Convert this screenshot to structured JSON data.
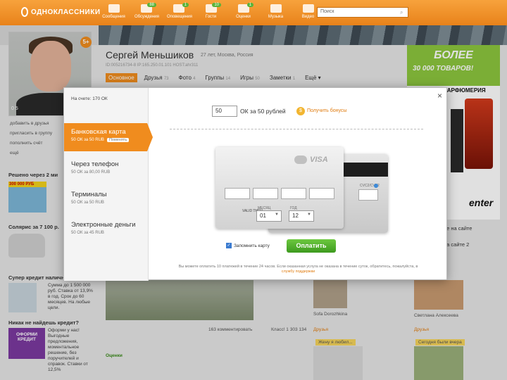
{
  "header": {
    "logo": "ОДНОКЛАССНИКИ",
    "nav": [
      {
        "label": "Сообщения",
        "badge": ""
      },
      {
        "label": "Обсуждения",
        "badge": "88"
      },
      {
        "label": "Оповещения",
        "badge": "1"
      },
      {
        "label": "Гости",
        "badge": "10"
      },
      {
        "label": "Оценки",
        "badge": "1"
      },
      {
        "label": "Музыка",
        "badge": ""
      },
      {
        "label": "Видео",
        "badge": ""
      }
    ],
    "search_placeholder": "Поиск"
  },
  "profile": {
    "name": "Сергей Меньшиков",
    "meta": "27 лет, Москва, Россия",
    "id_line": "ID:005216734-8  IP:165.250.01.101  HOST:ahr311",
    "badge": "5+",
    "stats": "0  5",
    "tabs": [
      {
        "label": "Основное",
        "count": "",
        "active": true
      },
      {
        "label": "Друзья",
        "count": "73",
        "active": false
      },
      {
        "label": "Фото",
        "count": "4",
        "active": false
      },
      {
        "label": "Группы",
        "count": "14",
        "active": false
      },
      {
        "label": "Игры",
        "count": "50",
        "active": false
      },
      {
        "label": "Заметки",
        "count": "1",
        "active": false
      },
      {
        "label": "Ещё ▾",
        "count": "",
        "active": false
      }
    ]
  },
  "left": {
    "links": [
      "добавить в друзья",
      "пригласить в группу",
      "пополнить счёт",
      "ещё"
    ],
    "ad1_title": "Решено через 2 ми",
    "ad1_badge": "300 000 РУБ",
    "ad2_title": "Солярис за 7 100 р.",
    "ad3_title": "Супер кредит наличн",
    "ad3_text": "Сумма до 1 500 000 руб. Ставка от 13,9% в год. Срок до 60 месяцев. На любые цели.",
    "ad4_title": "Никак не найдешь кредит?",
    "ad4_badge": "ОФОРМИ КРЕДИТ",
    "ad4_text": "Оформи у нас! Выгодные предложения, моментальное решение, без поручителей и справок. Ставки от 12,5%"
  },
  "main": {
    "comments_label": "163 комментировать",
    "class_label": "Класс! 1 303 134",
    "photo_caption": "Оценки",
    "friend_name": "Sofa Dorozhkina",
    "friend_sub": "Друзья",
    "friend2_name": "Светлана Алексеева",
    "friend2_sub": "Друзья",
    "friend_tag": "Жену я любил...",
    "friend2_tag": "Сегодня были вчера"
  },
  "right": {
    "ad1_line1": "БОЛЕЕ",
    "ad1_line2": "30 000 ТОВАРОВ!",
    "ad2_title": "МИРОВАЯ ПАРФЮМЕРИЯ",
    "logo": "enter",
    "link1": "не на сайте",
    "link2": "на сайте 2"
  },
  "modal": {
    "balance": "На счете: 170 ОК",
    "methods": [
      {
        "title": "Банковская карта",
        "sub": "50 ОК за 50 RUB",
        "active": true
      },
      {
        "title": "Через телефон",
        "sub": "50 ОК за 80,00 RUB",
        "active": false
      },
      {
        "title": "Терминалы",
        "sub": "50 ОК за 50 RUB",
        "active": false
      },
      {
        "title": "Электронные деньги",
        "sub": "50 ОК за 45 RUB",
        "active": false
      }
    ],
    "change_label": "Поменять",
    "amount_value": "50",
    "amount_label": "ОК за 50 рублей",
    "bonus_link": "Получить бонусы",
    "card_brand": "VISA",
    "cvc_label": "CVC2/CVV2",
    "month_small": "МЕСЯЦ",
    "year_small": "ГОД",
    "valid_label": "VALID THRU",
    "month_value": "01",
    "year_value": "12",
    "remember_label": "Запомнить карту",
    "pay_button": "Оплатить",
    "note": "Вы можете оплатить 10 платежей в течение 24 часов. Если оказанная услуга не оказана в течение суток, обратитесь, пожалуйста, в ",
    "note_link": "службу поддержки"
  },
  "colors": {
    "accent": "#f08c1e",
    "pay_green": "#4aae28",
    "ad_green": "#8cc63e"
  }
}
